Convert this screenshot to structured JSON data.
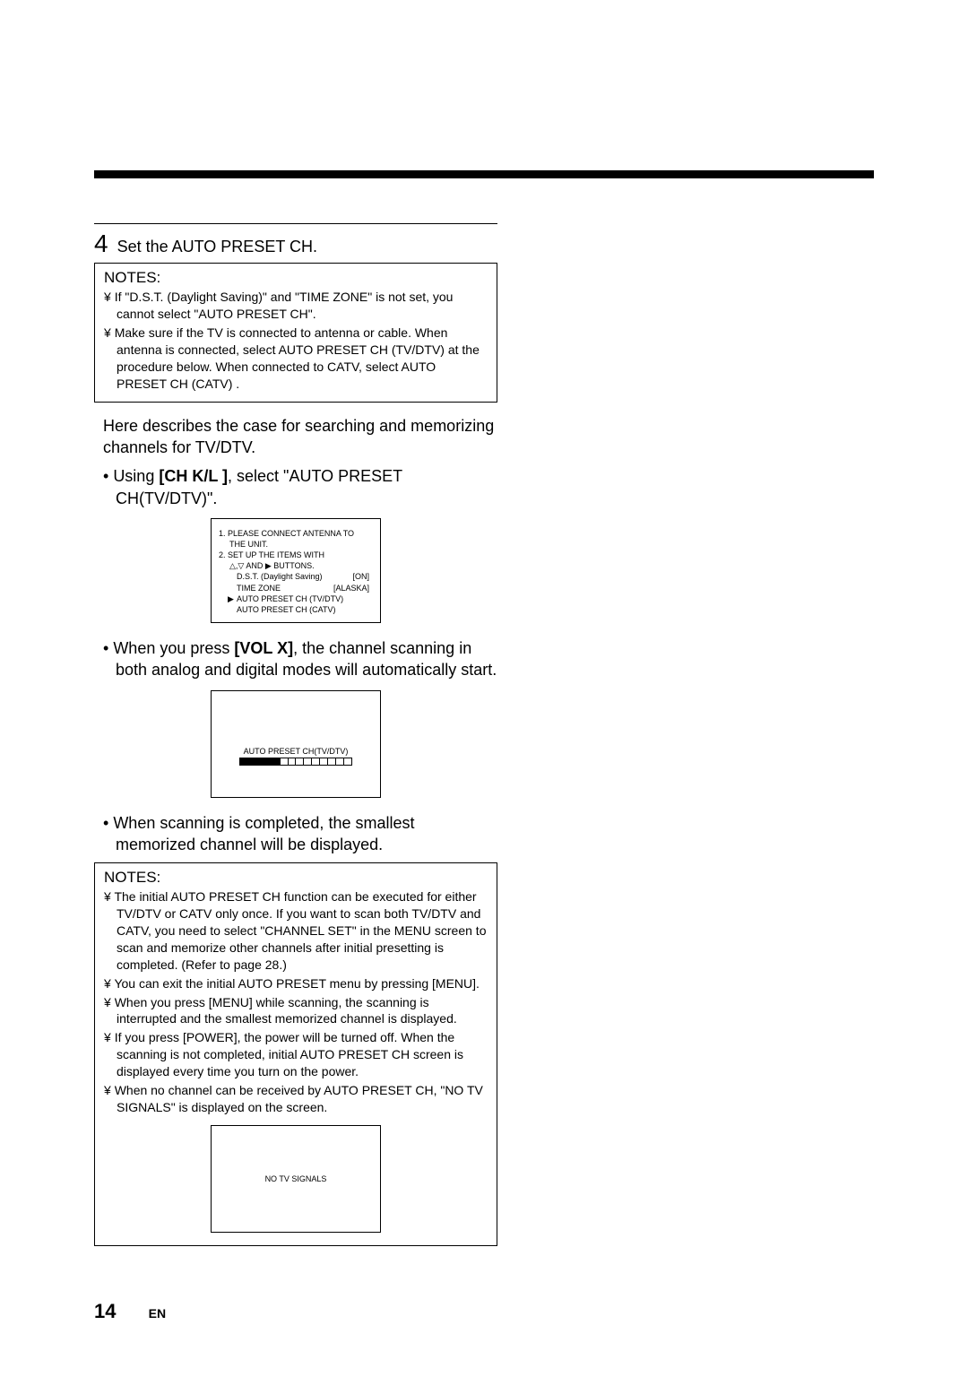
{
  "step": {
    "number": "4",
    "title": "Set the AUTO PRESET CH."
  },
  "notes1": {
    "heading": "NOTES:",
    "items": [
      "If \"D.S.T. (Daylight Saving)\" and \"TIME ZONE\" is not set, you cannot select \"AUTO PRESET CH\".",
      "Make sure if the TV is connected to antenna or cable. When antenna is connected, select  AUTO PRESET CH (TV/DTV)  at the procedure below.  When connected to CATV, select  AUTO PRESET CH (CATV) ."
    ]
  },
  "para_intro": "Here describes the case for searching and memorizing channels for TV/DTV.",
  "bullet_using_pre": "Using",
  "bullet_using_bold": "[CH K/L ]",
  "bullet_using_post": ", select \"AUTO PRESET CH(TV/DTV)\".",
  "osd1": {
    "l1": "1. PLEASE CONNECT ANTENNA TO",
    "l1b": "THE UNIT.",
    "l2": "2. SET UP THE ITEMS WITH",
    "l2b": "△,▽ AND ▶ BUTTONS.",
    "row1_label": "D.S.T. (Daylight Saving)",
    "row1_val": "[ON]",
    "row2_label": "TIME ZONE",
    "row2_val": "[ALASKA]",
    "arrow": "▶",
    "row3": "AUTO PRESET CH (TV/DTV)",
    "row4": "AUTO PRESET CH (CATV)"
  },
  "bullet_vol_pre": "When you press",
  "bullet_vol_bold": "[VOL X]",
  "bullet_vol_post": ", the channel scanning in both analog and digital modes will automatically start.",
  "scan": {
    "label": "AUTO PRESET CH(TV/DTV)"
  },
  "bullet_scan_done": "When scanning is completed, the smallest memorized channel will be displayed.",
  "notes2": {
    "heading": "NOTES:",
    "items": [
      "The initial AUTO PRESET CH function can be executed for either TV/DTV or CATV only once. If you want to scan both TV/DTV and CATV, you need to select \"CHANNEL SET\" in the MENU screen to scan and memorize other channels after initial presetting is completed. (Refer to page 28.)",
      "You can exit the initial AUTO PRESET menu by pressing [MENU].",
      "When you press [MENU] while scanning, the scanning is interrupted and the smallest memorized channel is displayed.",
      "If you press [POWER], the power will be turned off. When the scanning is not completed, initial AUTO PRESET CH screen is displayed every time you turn on the power.",
      "When no channel can be received by AUTO PRESET CH, \"NO TV SIGNALS\" is displayed on the screen."
    ]
  },
  "nosignal": "NO TV SIGNALS",
  "pagenum": "14",
  "pagelang": "EN"
}
